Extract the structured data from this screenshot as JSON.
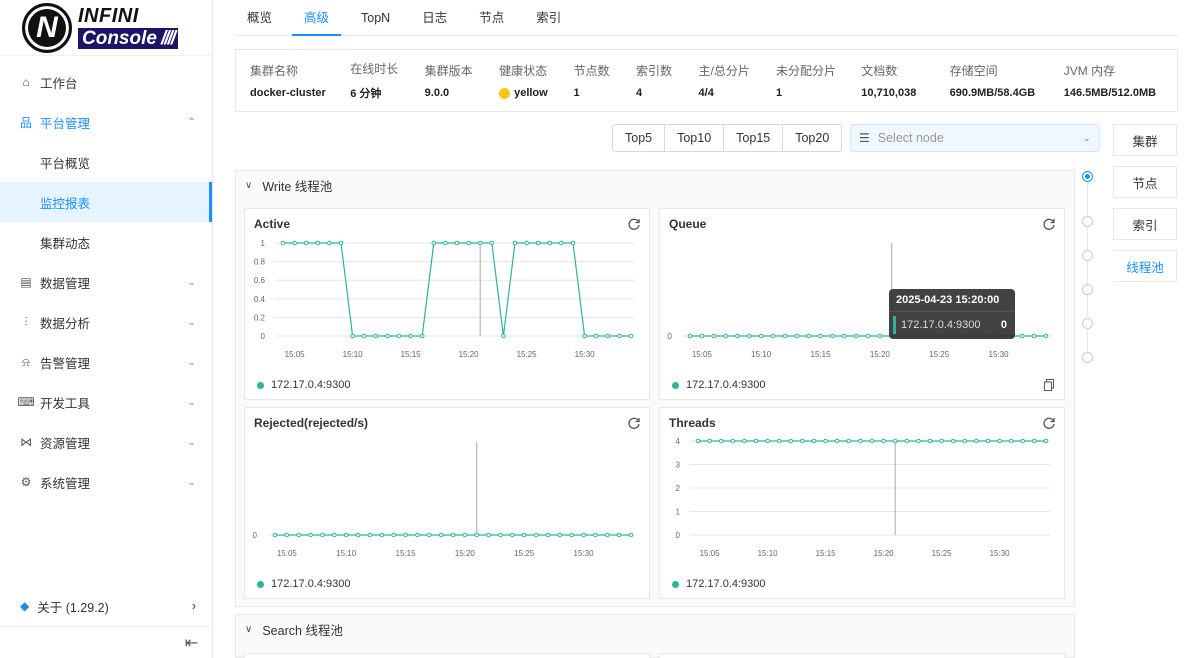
{
  "logo": {
    "infini": "INFINI",
    "console": "Console",
    "slashes": "////"
  },
  "sidebar": {
    "items": [
      {
        "key": "workbench",
        "label": "工作台",
        "icon": "home-icon",
        "glyph": "⌂",
        "chev": ""
      },
      {
        "key": "platform",
        "label": "平台管理",
        "icon": "cluster-icon",
        "glyph": "品",
        "chev": "⌃",
        "active": true
      }
    ],
    "subitems": [
      {
        "label": "平台概览"
      },
      {
        "label": "监控报表",
        "selected": true
      },
      {
        "label": "集群动态"
      }
    ],
    "items2": [
      {
        "key": "data-mgmt",
        "label": "数据管理",
        "icon": "database-icon",
        "glyph": "▤",
        "chev": "⌄"
      },
      {
        "key": "data-analysis",
        "label": "数据分析",
        "icon": "chart-icon",
        "glyph": "⫶",
        "chev": "⌄"
      },
      {
        "key": "alert",
        "label": "告警管理",
        "icon": "alarm-icon",
        "glyph": "⍾",
        "chev": "⌄"
      },
      {
        "key": "devtools",
        "label": "开发工具",
        "icon": "terminal-icon",
        "glyph": "⌨",
        "chev": "⌄"
      },
      {
        "key": "resource",
        "label": "资源管理",
        "icon": "share-icon",
        "glyph": "⋈",
        "chev": "⌄"
      },
      {
        "key": "system",
        "label": "系统管理",
        "icon": "gear-icon",
        "glyph": "⚙",
        "chev": "⌄"
      }
    ],
    "about": {
      "label": "关于 (1.29.2)",
      "glyph": "◆",
      "chev": "›"
    },
    "collapse_glyph": "⇤"
  },
  "tabs": [
    {
      "label": "概览"
    },
    {
      "label": "高级",
      "active": true
    },
    {
      "label": "TopN"
    },
    {
      "label": "日志"
    },
    {
      "label": "节点"
    },
    {
      "label": "索引"
    }
  ],
  "cluster_info": [
    {
      "label": "集群名称",
      "value": "docker-cluster",
      "w": 101
    },
    {
      "label": "在线时长",
      "value": "6 分钟",
      "w": 75
    },
    {
      "label": "集群版本",
      "value": "9.0.0",
      "w": 75
    },
    {
      "label": "健康状态",
      "value": "yellow",
      "w": 75,
      "dot": true
    },
    {
      "label": "节点数",
      "value": "1",
      "w": 63
    },
    {
      "label": "索引数",
      "value": "4",
      "w": 63
    },
    {
      "label": "主/总分片",
      "value": "4/4",
      "w": 78
    },
    {
      "label": "未分配分片",
      "value": "1",
      "w": 86
    },
    {
      "label": "文档数",
      "value": "10,710,038",
      "w": 89
    },
    {
      "label": "存储空间",
      "value": "690.9MB/58.4GB",
      "w": 115
    },
    {
      "label": "JVM 内存",
      "value": "146.5MB/512.0MB",
      "w": 100
    }
  ],
  "top_buttons": [
    "Top5",
    "Top10",
    "Top15",
    "Top20"
  ],
  "node_select": {
    "placeholder": "Select node"
  },
  "right_tabs": [
    {
      "label": "集群"
    },
    {
      "label": "节点"
    },
    {
      "label": "索引"
    },
    {
      "label": "线程池",
      "active": true
    }
  ],
  "panels": {
    "write": "Write 线程池",
    "search": "Search 线程池"
  },
  "legend_node": "172.17.0.4:9300",
  "tooltip": {
    "title": "2025-04-23 15:20:00",
    "name": "172.17.0.4:9300",
    "value": "0"
  },
  "chart_data": [
    {
      "type": "line",
      "title": "Active",
      "x_ticks": [
        "15:05",
        "15:10",
        "15:15",
        "15:20",
        "15:25",
        "15:30"
      ],
      "y_ticks": [
        "0",
        "0.2",
        "0.4",
        "0.6",
        "0.8",
        "1"
      ],
      "ylim": [
        0,
        1
      ],
      "series": [
        {
          "name": "172.17.0.4:9300",
          "values": [
            1,
            1,
            1,
            1,
            1,
            1,
            0,
            0,
            0,
            0,
            0,
            0,
            0,
            1,
            1,
            1,
            1,
            1,
            1,
            0,
            1,
            1,
            1,
            1,
            1,
            1,
            0,
            0,
            0,
            0,
            0
          ]
        }
      ],
      "cursor_index": 17
    },
    {
      "type": "line",
      "title": "Queue",
      "x_ticks": [
        "15:05",
        "15:10",
        "15:15",
        "15:20",
        "15:25",
        "15:30"
      ],
      "y_ticks": [
        "0"
      ],
      "ylim": [
        0,
        1
      ],
      "series": [
        {
          "name": "172.17.0.4:9300",
          "values": [
            0,
            0,
            0,
            0,
            0,
            0,
            0,
            0,
            0,
            0,
            0,
            0,
            0,
            0,
            0,
            0,
            0,
            0,
            0,
            0,
            0,
            0,
            0,
            0,
            0,
            0,
            0,
            0,
            0,
            0,
            0
          ]
        }
      ],
      "cursor_index": 17
    },
    {
      "type": "line",
      "title": "Rejected(rejected/s)",
      "x_ticks": [
        "15:05",
        "15:10",
        "15:15",
        "15:20",
        "15:25",
        "15:30"
      ],
      "y_ticks": [
        "0"
      ],
      "ylim": [
        0,
        1
      ],
      "series": [
        {
          "name": "172.17.0.4:9300",
          "values": [
            0,
            0,
            0,
            0,
            0,
            0,
            0,
            0,
            0,
            0,
            0,
            0,
            0,
            0,
            0,
            0,
            0,
            0,
            0,
            0,
            0,
            0,
            0,
            0,
            0,
            0,
            0,
            0,
            0,
            0,
            0
          ]
        }
      ],
      "cursor_index": 17
    },
    {
      "type": "line",
      "title": "Threads",
      "x_ticks": [
        "15:05",
        "15:10",
        "15:15",
        "15:20",
        "15:25",
        "15:30"
      ],
      "y_ticks": [
        "0",
        "1",
        "2",
        "3",
        "4"
      ],
      "ylim": [
        0,
        4
      ],
      "series": [
        {
          "name": "172.17.0.4:9300",
          "values": [
            4,
            4,
            4,
            4,
            4,
            4,
            4,
            4,
            4,
            4,
            4,
            4,
            4,
            4,
            4,
            4,
            4,
            4,
            4,
            4,
            4,
            4,
            4,
            4,
            4,
            4,
            4,
            4,
            4,
            4,
            4
          ]
        }
      ],
      "cursor_index": 17
    }
  ],
  "colors": {
    "accent": "#1890ff",
    "series": "#2eb398",
    "health": "#f5c518"
  }
}
